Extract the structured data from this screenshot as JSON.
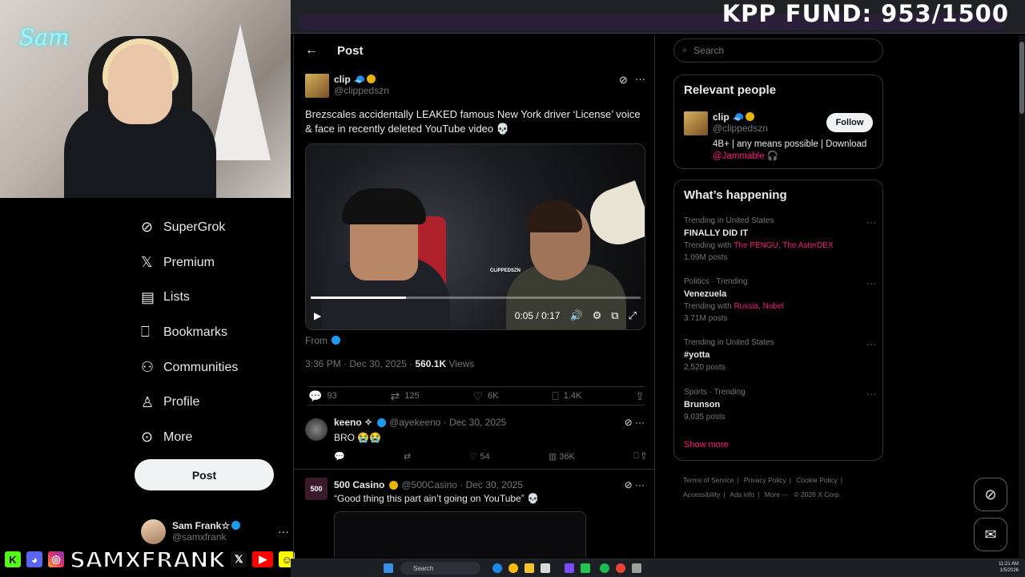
{
  "overlay": {
    "fund_text": "KPP FUND: 953/1500",
    "webcam_neon": "Sam",
    "social_brand": "SAMXFRANK"
  },
  "sidebar": {
    "items": [
      {
        "label": "SuperGrok",
        "icon": "grok-icon"
      },
      {
        "label": "Premium",
        "icon": "x-logo-icon"
      },
      {
        "label": "Lists",
        "icon": "list-icon"
      },
      {
        "label": "Bookmarks",
        "icon": "bookmark-icon"
      },
      {
        "label": "Communities",
        "icon": "communities-icon"
      },
      {
        "label": "Profile",
        "icon": "profile-icon"
      },
      {
        "label": "More",
        "icon": "more-circle-icon"
      }
    ],
    "post_button": "Post",
    "account": {
      "name": "Sam Frank☆",
      "handle": "@samxfrank",
      "menu": "···"
    }
  },
  "main": {
    "header_title": "Post",
    "back_icon": "←",
    "tweet": {
      "author_name": "clip",
      "author_handle": "@clippedszn",
      "text": "Brezscales accidentally LEAKED famous New York driver ‘License’ voice & face in recently deleted YouTube video 💀",
      "video": {
        "watermark": "CLIPPEDSZN",
        "time": "0:05 / 0:17",
        "progress": 0.29
      },
      "from_label": "From",
      "timestamp": "3:36 PM · Dec 30, 2025 ·",
      "views_count": "560.1K",
      "views_label": "Views",
      "stats": {
        "replies": "93",
        "reposts": "125",
        "likes": "6K",
        "bookmarks": "1.4K"
      }
    },
    "replies": [
      {
        "name": "keeno ✧",
        "handle": "@ayekeeno · Dec 30, 2025",
        "text": "BRO 😭😭",
        "likes": "54",
        "views": "36K"
      },
      {
        "name": "500 Casino",
        "handle": "@500Casino · Dec 30, 2025",
        "text": "“Good thing this part ain’t going on YouTube” 💀",
        "avatar_text": "500"
      }
    ]
  },
  "right": {
    "search_placeholder": "Search",
    "relevant": {
      "title": "Relevant people",
      "name": "clip",
      "handle": "@clippedszn",
      "follow": "Follow",
      "bio": "4B+ | any means possible | Download",
      "bio_link": "@Jammable 🎧"
    },
    "happening": {
      "title": "What’s happening",
      "trends": [
        {
          "category": "Trending in United States",
          "title": "FINALLY DID IT",
          "with_prefix": "Trending with",
          "with_1": "The PENGU",
          "with_sep": ",",
          "with_2": "The AsterDEX",
          "count": "1.09M posts"
        },
        {
          "category": "Politics · Trending",
          "title": "Venezuela",
          "with_prefix": "Trending with",
          "with_1": "Russia",
          "with_sep": ",",
          "with_2": "Nobel",
          "count": "3.71M posts"
        },
        {
          "category": "Trending in United States",
          "title": "#yotta",
          "count": "2,520 posts"
        },
        {
          "category": "Sports · Trending",
          "title": "Brunson",
          "count": "9,035 posts"
        }
      ],
      "show_more": "Show more"
    },
    "footer": [
      "Terms of Service",
      "|",
      "Privacy Policy",
      "|",
      "Cookie Policy",
      "|",
      "Accessibility",
      "|",
      "Ads info",
      "|",
      "More ···",
      "© 2026 X Corp."
    ]
  },
  "taskbar": {
    "search": "Search",
    "time": "11:21 AM",
    "date": "1/5/2026"
  },
  "colors": {
    "accent_pink": "#f91880",
    "verified_blue": "#1d9bf0",
    "verified_gold": "#e9b500",
    "background": "#000000"
  }
}
